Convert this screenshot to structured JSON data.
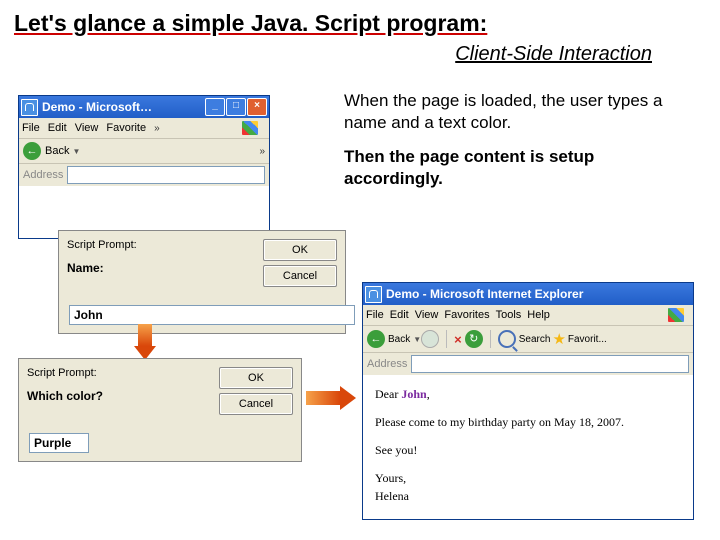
{
  "title": "Let's glance a simple Java. Script program:",
  "subtitle": "Client-Side Interaction",
  "desc": {
    "p1": "When the page is loaded, the user types a name and a text color.",
    "p2": "Then the page content is setup accordingly."
  },
  "ie_small": {
    "title": "Demo - Microsoft…",
    "menu": {
      "file": "File",
      "edit": "Edit",
      "view": "View",
      "fav": "Favorite",
      "chev": "»"
    },
    "toolbar": {
      "back": "Back",
      "chev": "»"
    },
    "addr_label": "Address"
  },
  "dlg1": {
    "title": "Script Prompt:",
    "label": "Name:",
    "value": "John",
    "ok": "OK",
    "cancel": "Cancel"
  },
  "dlg2": {
    "title": "Script Prompt:",
    "label": "Which color?",
    "value": "Purple",
    "ok": "OK",
    "cancel": "Cancel"
  },
  "result": {
    "title": "Demo - Microsoft Internet Explorer",
    "menu": {
      "file": "File",
      "edit": "Edit",
      "view": "View",
      "fav": "Favorites",
      "tools": "Tools",
      "help": "Help"
    },
    "toolbar": {
      "back": "Back",
      "search": "Search",
      "favorites": "Favorit..."
    },
    "addr_label": "Address",
    "body": {
      "dear": "Dear ",
      "name": "John",
      "comma": ",",
      "invite": "Please come to my birthday party on May 18, 2007.",
      "see": "See you!",
      "yours": "Yours,",
      "sign": "Helena"
    }
  }
}
